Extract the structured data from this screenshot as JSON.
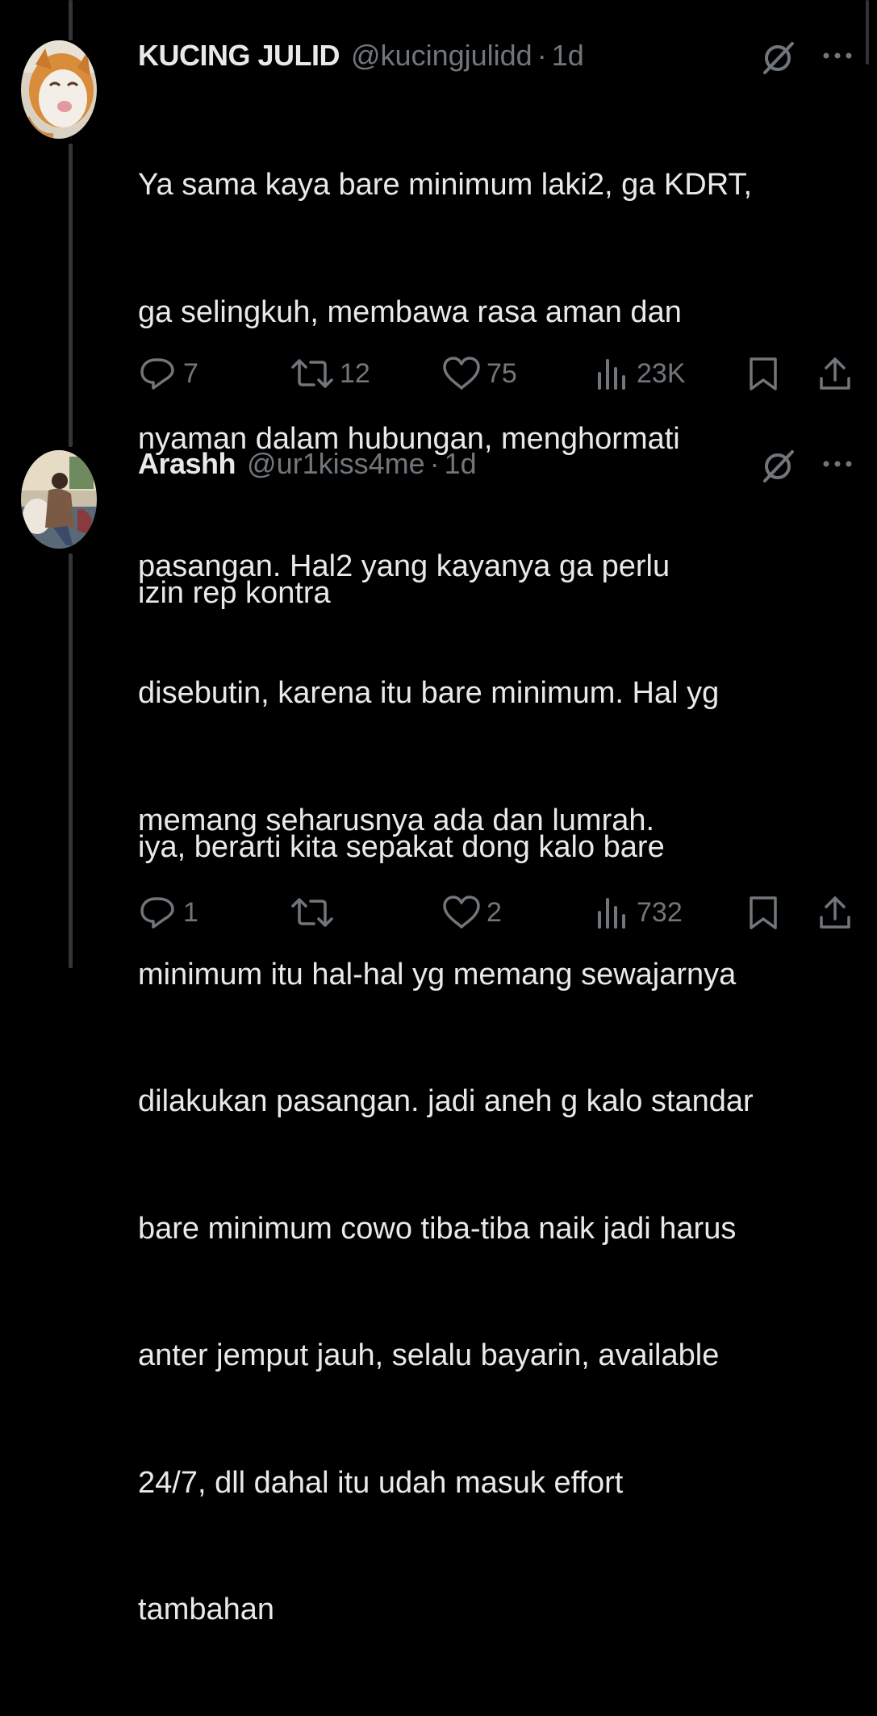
{
  "tweets": [
    {
      "display_name": "KUCING JULID",
      "handle": "@kucingjulidd",
      "separator": "·",
      "time": "1d",
      "body_lines": [
        "Ya sama kaya bare minimum laki2, ga KDRT,",
        "ga selingkuh, membawa rasa aman dan",
        "nyaman dalam hubungan, menghormati",
        "pasangan. Hal2 yang kayanya ga perlu",
        "disebutin, karena itu bare minimum. Hal yg",
        "memang seharusnya ada dan lumrah."
      ],
      "replies": "7",
      "reposts": "12",
      "likes": "75",
      "views": "23K"
    },
    {
      "display_name": "Arashh",
      "handle": "@ur1kiss4me",
      "separator": "·",
      "time": "1d",
      "body_lines": [
        "izin rep kontra",
        "",
        "iya, berarti kita sepakat dong kalo bare",
        "minimum itu hal-hal yg memang sewajarnya",
        "dilakukan pasangan. jadi aneh g kalo standar",
        "bare minimum cowo tiba-tiba naik jadi harus",
        "anter jemput jauh, selalu bayarin, available",
        "24/7, dll dahal itu udah masuk effort",
        "tambahan"
      ],
      "replies": "1",
      "reposts": "",
      "likes": "2",
      "views": "732"
    }
  ],
  "icons": {
    "reply": "reply-icon",
    "repost": "repost-icon",
    "like": "heart-icon",
    "views": "views-icon",
    "bookmark": "bookmark-icon",
    "share": "share-icon",
    "grok": "grok-icon",
    "more": "more-icon"
  },
  "colors": {
    "background": "#000000",
    "text": "#e7e9ea",
    "muted": "#71767b",
    "thread_line": "#333639"
  }
}
